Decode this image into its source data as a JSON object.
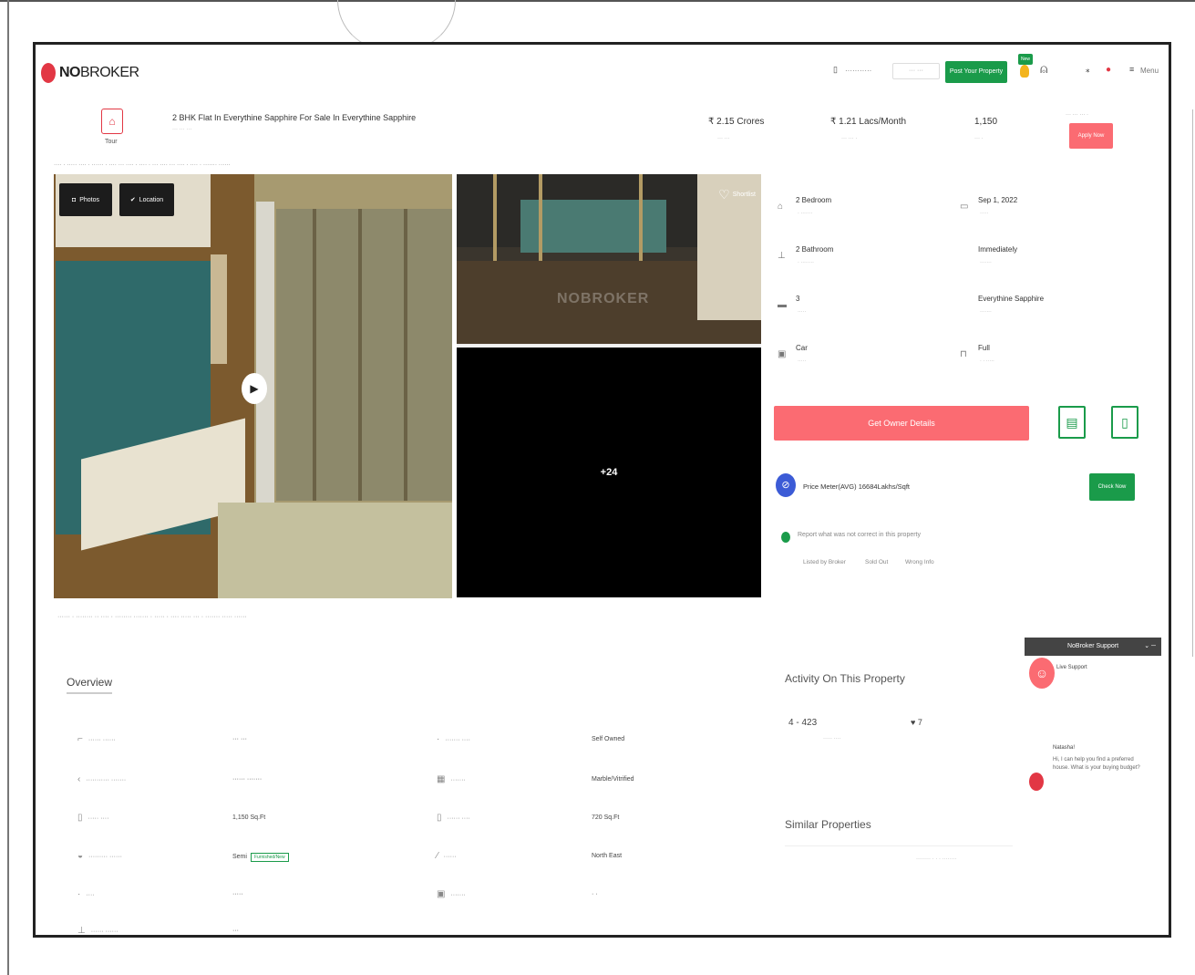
{
  "header": {
    "logo_bold": "NO",
    "logo_thin": "BROKER",
    "post_button": "Post Your Property",
    "new_badge": "New",
    "menu_label": "Menu"
  },
  "property": {
    "tour_label": "Tour",
    "title": "2 BHK Flat In Everythine Sapphire For Sale In Everythine Sapphire",
    "price": "₹ 2.15 Crores",
    "emi": "₹ 1.21 Lacs/Month",
    "area": "1,150",
    "apply_button": "Apply Now"
  },
  "gallery": {
    "photos_label": "Photos",
    "location_label": "Location",
    "shortlist_label": "Shortlist",
    "watermark": "NOBROKER",
    "more_count": "+24"
  },
  "details": [
    {
      "icon": "bed-icon",
      "glyph": "⌂",
      "value": "2 Bedroom"
    },
    {
      "icon": "calendar-icon",
      "glyph": "▭",
      "value": "Sep 1, 2022"
    },
    {
      "icon": "bathroom-icon",
      "glyph": "⊥",
      "value": "2 Bathroom"
    },
    {
      "icon": "possession-icon",
      "glyph": "",
      "value": "Immediately"
    },
    {
      "icon": "balcony-icon",
      "glyph": "▬",
      "value": "3"
    },
    {
      "icon": "society-icon",
      "glyph": "",
      "value": "Everythine Sapphire"
    },
    {
      "icon": "parking-icon",
      "glyph": "▣",
      "value": "Car"
    },
    {
      "icon": "furnishing-icon",
      "glyph": "⊓",
      "value": "Full"
    }
  ],
  "actions": {
    "owner_button": "Get Owner Details",
    "price_meter_text": "Price Meter(AVG) 16684Lakhs/Sqft",
    "check_button": "Check Now",
    "report_text": "Report what was not correct in this property",
    "report_options": [
      "Listed by Broker",
      "Sold Out",
      "Wrong Info"
    ]
  },
  "overview": {
    "title": "Overview",
    "rows": [
      {
        "icon": "building-icon",
        "value": "Self Owned"
      },
      {
        "icon": "flooring-icon",
        "value": "Marble/Vitrified"
      },
      {
        "icon": "area-icon",
        "value": "1,150 Sq.Ft"
      },
      {
        "icon": "carpet-icon",
        "value": "720 Sq.Ft"
      },
      {
        "icon": "status-icon",
        "value": "Semi",
        "tag": "Furnished/New"
      },
      {
        "icon": "facing-icon",
        "value": "North East"
      }
    ]
  },
  "activity": {
    "title": "Activity On This Property",
    "count": "4 - 423",
    "heart": "♥ 7",
    "similar_title": "Similar Properties"
  },
  "support": {
    "bar_label": "NoBroker Support",
    "live_label": "Live Support",
    "chat_name": "Natasha!",
    "chat_text": "Hi, I can help you find a preferred house. What is your buying budget?"
  }
}
